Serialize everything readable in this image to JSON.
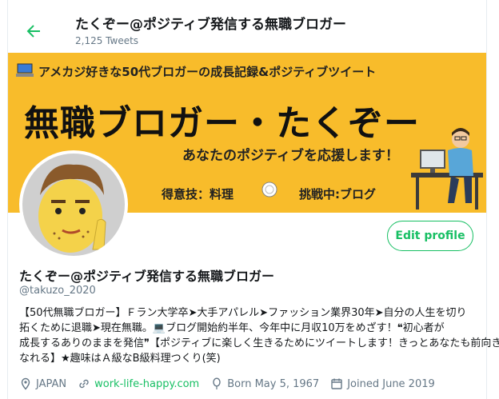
{
  "header": {
    "title": "たくぞー@ポジティブ発信する無職ブロガー",
    "tweet_count": "2,125 Tweets"
  },
  "banner": {
    "top_line": "アメカジ好きな50代ブロガーの成長記録&ポジティブツイート",
    "main_title": "無職ブロガー・たくぞー",
    "subtitle": "あなたのポジティブを応援します！",
    "skill": "得意技：料理",
    "challenge": "挑戦中:ブログ"
  },
  "profile": {
    "edit_label": "Edit profile",
    "name": "たくぞー@ポジティブ発信する無職ブロガー",
    "handle": "@takuzo_2020",
    "bio_lines": [
      "【50代無職ブロガー】Ｆラン大学卒➤大手アパレル➤ファッション業界30年➤自分の人生を切り",
      "拓くために退職➤現在無職。💻ブログ開始約半年、今年中に月収10万をめざす！❝初心者が",
      "成長するありのままを発信❞【ポジティブに楽しく生きるためにツイートします！きっとあなたも前向きに",
      "なれる】★趣味はＡ級なB級料理つくり(笑)"
    ],
    "location": "JAPAN",
    "website": "work-life-happy.com",
    "born": "Born May 5, 1967",
    "joined": "Joined June 2019"
  },
  "colors": {
    "accent": "#17bf63",
    "banner_bg": "#f8bc2b",
    "muted": "#657786"
  },
  "icons": {
    "back": "arrow-left-icon",
    "location": "location-pin-icon",
    "website": "link-icon",
    "born": "balloon-icon",
    "joined": "calendar-icon"
  }
}
